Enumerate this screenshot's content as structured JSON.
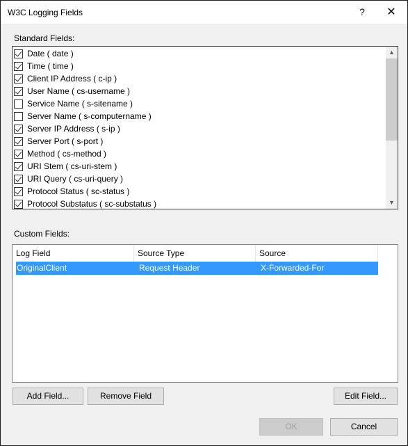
{
  "window": {
    "title": "W3C Logging Fields",
    "help_label": "?",
    "close_label": "✕"
  },
  "standard_fields": {
    "label": "Standard Fields:",
    "items": [
      {
        "label": "Date ( date )",
        "checked": true
      },
      {
        "label": "Time ( time )",
        "checked": true
      },
      {
        "label": "Client IP Address ( c-ip )",
        "checked": true
      },
      {
        "label": "User Name ( cs-username )",
        "checked": true
      },
      {
        "label": "Service Name ( s-sitename )",
        "checked": false
      },
      {
        "label": "Server Name ( s-computername )",
        "checked": false
      },
      {
        "label": "Server IP Address ( s-ip )",
        "checked": true
      },
      {
        "label": "Server Port ( s-port )",
        "checked": true
      },
      {
        "label": "Method ( cs-method )",
        "checked": true
      },
      {
        "label": "URI Stem ( cs-uri-stem )",
        "checked": true
      },
      {
        "label": "URI Query ( cs-uri-query )",
        "checked": true
      },
      {
        "label": "Protocol Status ( sc-status )",
        "checked": true
      },
      {
        "label": "Protocol Substatus ( sc-substatus )",
        "checked": true
      }
    ],
    "scroll_up_icon": "▲",
    "scroll_down_icon": "▼"
  },
  "custom_fields": {
    "label": "Custom Fields:",
    "columns": [
      "Log Field",
      "Source Type",
      "Source"
    ],
    "rows": [
      {
        "log_field": "OriginalClient",
        "source_type": "Request Header",
        "source": "X-Forwarded-For",
        "selected": true
      }
    ],
    "selection_color": "#3399ff"
  },
  "buttons": {
    "add": "Add Field...",
    "remove": "Remove Field",
    "edit": "Edit Field...",
    "ok": "OK",
    "cancel": "Cancel"
  }
}
